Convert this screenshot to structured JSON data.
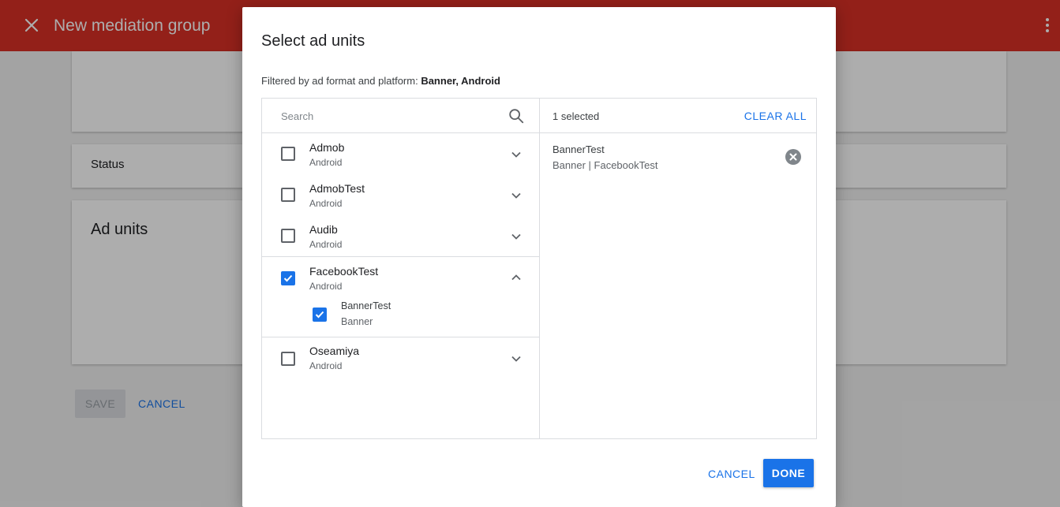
{
  "appbar": {
    "title": "New mediation group",
    "color": "#d93025"
  },
  "background": {
    "status_label": "Status",
    "ad_units_label": "Ad units",
    "save_label": "SAVE",
    "cancel_label": "CANCEL"
  },
  "dialog": {
    "title": "Select ad units",
    "filter_prefix": "Filtered by ad format and platform: ",
    "filter_value": "Banner, Android",
    "search_placeholder": "Search",
    "selected_count": "1 selected",
    "clear_all_label": "CLEAR ALL",
    "apps": [
      {
        "name": "Admob",
        "platform": "Android",
        "checked": false,
        "expanded": false
      },
      {
        "name": "AdmobTest",
        "platform": "Android",
        "checked": false,
        "expanded": false
      },
      {
        "name": "Audib",
        "platform": "Android",
        "checked": false,
        "expanded": false
      },
      {
        "name": "FacebookTest",
        "platform": "Android",
        "checked": true,
        "expanded": true,
        "units": [
          {
            "name": "BannerTest",
            "format": "Banner",
            "checked": true
          }
        ]
      },
      {
        "name": "Oseamiya",
        "platform": "Android",
        "checked": false,
        "expanded": false
      }
    ],
    "selected": [
      {
        "name": "BannerTest",
        "detail": "Banner | FacebookTest"
      }
    ],
    "cancel_label": "CANCEL",
    "done_label": "DONE"
  },
  "colors": {
    "accent": "#1a73e8",
    "divider": "#dadce0"
  }
}
